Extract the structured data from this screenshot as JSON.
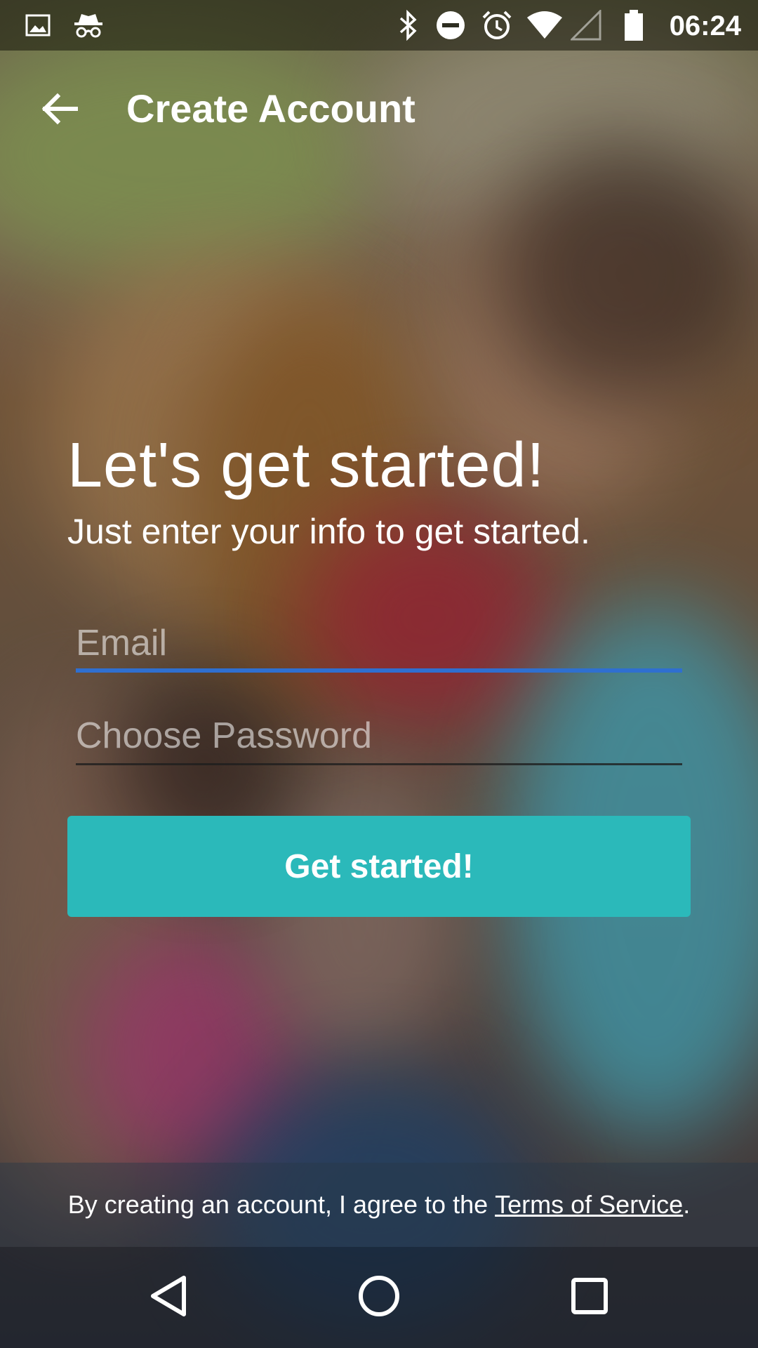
{
  "status_bar": {
    "time": "06:24",
    "left_icons": [
      "image-icon",
      "incognito-icon"
    ],
    "right_icons": [
      "bluetooth-icon",
      "do-not-disturb-icon",
      "alarm-icon",
      "wifi-icon",
      "cell-signal-icon",
      "battery-icon"
    ]
  },
  "app_bar": {
    "back_icon": "arrow-left-icon",
    "title": "Create Account"
  },
  "main": {
    "heading": "Let's get started!",
    "subheading": "Just enter your info to get started.",
    "email": {
      "placeholder": "Email",
      "value": ""
    },
    "password": {
      "placeholder": "Choose Password",
      "value": ""
    },
    "cta_label": "Get started!"
  },
  "footer": {
    "terms_prefix": "By creating an account, I agree to the ",
    "terms_link": "Terms of Service",
    "terms_suffix": "."
  },
  "nav_bar": {
    "icons": [
      "back-triangle-icon",
      "home-circle-icon",
      "recents-square-icon"
    ]
  },
  "colors": {
    "accent_button": "#2bb9ba",
    "focused_underline": "#2f6fd0"
  }
}
